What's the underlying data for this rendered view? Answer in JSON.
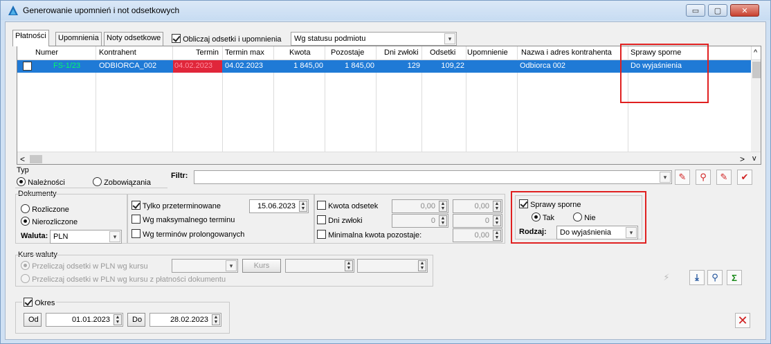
{
  "window": {
    "title": "Generowanie upomnień i not odsetkowych",
    "minimize": "▭",
    "maximize": "▢",
    "close": "✕"
  },
  "tabs": [
    {
      "label": "Płatności"
    },
    {
      "label": "Upomnienia"
    },
    {
      "label": "Noty odsetkowe"
    }
  ],
  "calc_checkbox_label": "Obliczaj odsetki i upomnienia",
  "status_combo": "Wg statusu podmiotu",
  "grid": {
    "headers": [
      "Numer",
      "Kontrahent",
      "Termin",
      "Termin max",
      "Kwota",
      "Pozostaje",
      "Dni zwłoki",
      "Odsetki",
      "Upomnienie",
      "Nazwa i adres kontrahenta",
      "Sprawy sporne"
    ],
    "row": {
      "numer": "FS-1/23",
      "kontrahent": "ODBIORCA_002",
      "termin": "04.02.2023",
      "termin_max": "04.02.2023",
      "kwota": "1 845,00",
      "pozostaje": "1 845,00",
      "dni_zwloki": "129",
      "odsetki": "109,22",
      "upomnienie": "",
      "nazwa": "Odbiorca 002",
      "sprawy_sporne": "Do wyjaśnienia"
    }
  },
  "typ": {
    "label": "Typ",
    "naleznosci": "Należności",
    "zobowiazania": "Zobowiązania"
  },
  "filtr_label": "Filtr:",
  "dokumenty": {
    "label": "Dokumenty",
    "rozliczone": "Rozliczone",
    "nierozliczone": "Nierozliczone",
    "waluta_label": "Waluta:",
    "waluta_value": "PLN"
  },
  "options": {
    "tylko_przeterminowane": "Tylko przeterminowane",
    "date": "15.06.2023",
    "wg_max": "Wg maksymalnego terminu",
    "wg_prolong": "Wg terminów prolongowanych",
    "kwota_odsetek": "Kwota odsetek",
    "kwota_odsetek_from": "0,00",
    "kwota_odsetek_to": "0,00",
    "dni_zwloki": "Dni zwłoki",
    "dni_from": "0",
    "dni_to": "0",
    "min_kwota": "Minimalna kwota pozostaje:",
    "min_kwota_value": "0,00"
  },
  "sprawy": {
    "label": "Sprawy sporne",
    "tak": "Tak",
    "nie": "Nie",
    "rodzaj_label": "Rodzaj:",
    "rodzaj_value": "Do wyjaśnienia"
  },
  "kurs": {
    "label": "Kurs waluty",
    "opt1": "Przeliczaj odsetki w PLN wg kursu",
    "opt2": "Przeliczaj odsetki w PLN wg kursu z płatności dokumentu",
    "kurs_btn": "Kurs"
  },
  "okres": {
    "label": "Okres",
    "od_btn": "Od",
    "od_value": "01.01.2023",
    "do_btn": "Do",
    "do_value": "28.02.2023"
  },
  "colors": {
    "selection": "#1f7ad6",
    "numer_text": "#00ff66",
    "termin_bg": "#e0263a",
    "highlight": "#e02020"
  }
}
